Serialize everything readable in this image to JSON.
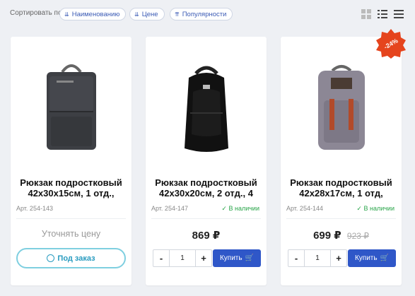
{
  "sort": {
    "label": "Сортировать по",
    "options": [
      "Наименованию",
      "Цене",
      "Популярности"
    ]
  },
  "view_icons": [
    "grid-view-icon",
    "list-view-icon",
    "compact-list-icon"
  ],
  "accent_color": "#2f57c8",
  "products": [
    {
      "title": "Рюкзак подростковый 42х30х15см, 1 отд.,",
      "article": "Арт. 254-143",
      "price_request": "Уточнять цену",
      "action_label": "Под заказ"
    },
    {
      "title": "Рюкзак подростковый 42х30х20см, 2 отд., 4",
      "article": "Арт. 254-147",
      "stock": "В наличии",
      "price": "869 ₽",
      "qty": "1",
      "buy_label": "Купить"
    },
    {
      "title": "Рюкзак подростковый 42х28х17см, 1 отд,",
      "article": "Арт. 254-144",
      "stock": "В наличии",
      "price": "699 ₽",
      "old_price": "923 ₽",
      "qty": "1",
      "buy_label": "Купить",
      "discount_badge": "-24%"
    }
  ]
}
